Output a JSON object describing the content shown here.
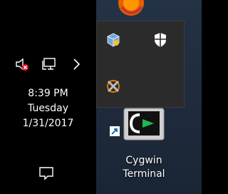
{
  "taskbar": {
    "clock": {
      "time": "8:39 PM",
      "day": "Tuesday",
      "date": "1/31/2017"
    },
    "tray_icons": [
      {
        "icon": "volume-muted-icon"
      },
      {
        "icon": "network-icon"
      },
      {
        "icon": "chevron-right-icon"
      }
    ],
    "action_center_icon": "action-center-icon"
  },
  "overflow_tray": {
    "icons": [
      "virtualbox-icon",
      "windows-defender-icon",
      "xming-icon"
    ]
  },
  "desktop": {
    "shortcut": {
      "line1": "Cygwin",
      "line2": "Terminal",
      "icon": "cygwin-terminal-icon"
    }
  },
  "colors": {
    "taskbar_bg": "#000000",
    "popup_bg": "#2b2b2b",
    "muted_badge": "#e81123",
    "cygwin_green": "#1db954"
  }
}
